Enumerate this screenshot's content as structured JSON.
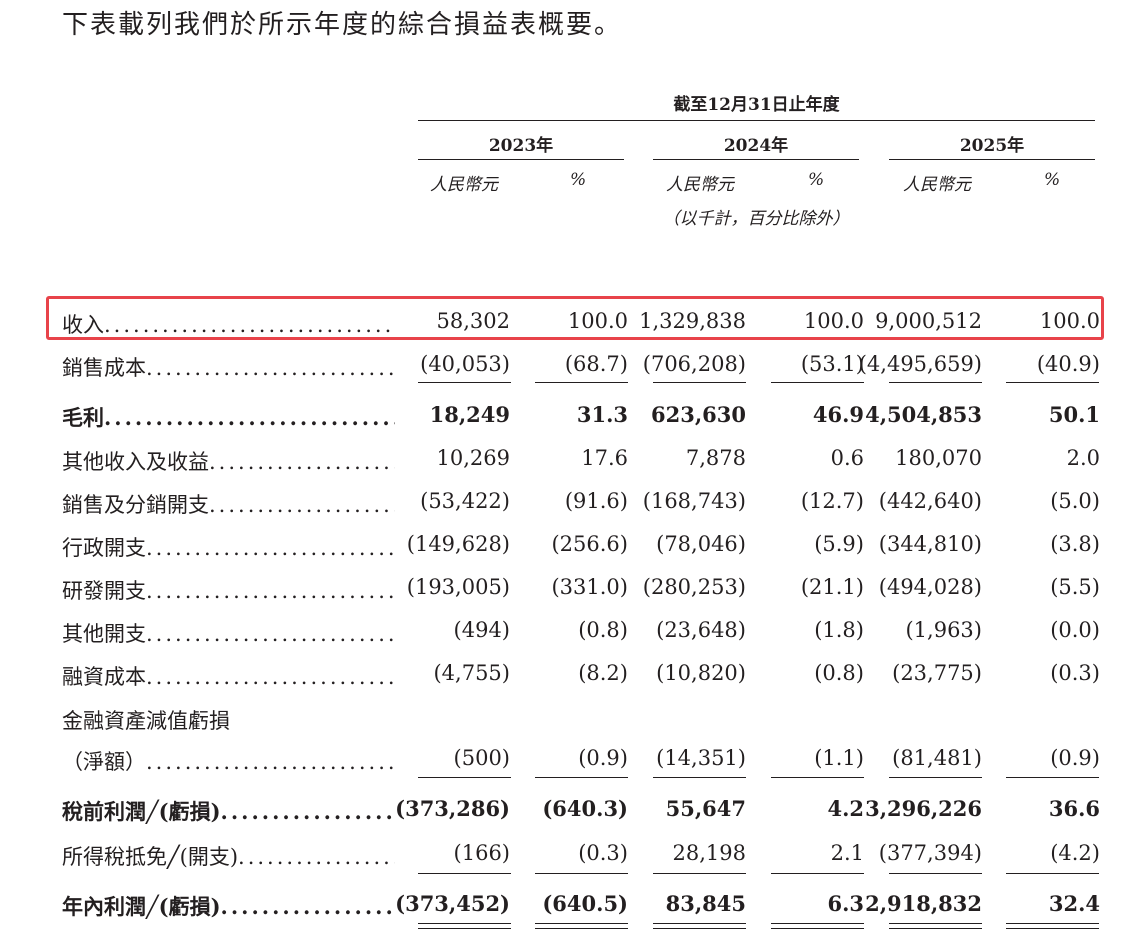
{
  "intro": "下表載列我們於所示年度的綜合損益表概要。",
  "period_header": "截至12月31日止年度",
  "years": [
    "2023年",
    "2024年",
    "2025年"
  ],
  "unit_rmb": "人民幣元",
  "unit_pct": "%",
  "unit_note": "（以千計，百分比除外）",
  "leader": "...............................",
  "rows": [
    {
      "label": "收入",
      "values": [
        "58,302",
        "100.0",
        "1,329,838",
        "100.0",
        "9,000,512",
        "100.0"
      ]
    },
    {
      "label": "銷售成本",
      "values": [
        "(40,053)",
        "(68.7)",
        "(706,208)",
        "(53.1)",
        "(4,495,659)",
        "(40.9)"
      ]
    },
    {
      "label": "毛利",
      "values": [
        "18,249",
        "31.3",
        "623,630",
        "46.9",
        "4,504,853",
        "50.1"
      ]
    },
    {
      "label": "其他收入及收益",
      "values": [
        "10,269",
        "17.6",
        "7,878",
        "0.6",
        "180,070",
        "2.0"
      ]
    },
    {
      "label": "銷售及分銷開支",
      "values": [
        "(53,422)",
        "(91.6)",
        "(168,743)",
        "(12.7)",
        "(442,640)",
        "(5.0)"
      ]
    },
    {
      "label": "行政開支",
      "values": [
        "(149,628)",
        "(256.6)",
        "(78,046)",
        "(5.9)",
        "(344,810)",
        "(3.8)"
      ]
    },
    {
      "label": "研發開支",
      "values": [
        "(193,005)",
        "(331.0)",
        "(280,253)",
        "(21.1)",
        "(494,028)",
        "(5.5)"
      ]
    },
    {
      "label": "其他開支",
      "values": [
        "(494)",
        "(0.8)",
        "(23,648)",
        "(1.8)",
        "(1,963)",
        "(0.0)"
      ]
    },
    {
      "label": "融資成本",
      "values": [
        "(4,755)",
        "(8.2)",
        "(10,820)",
        "(0.8)",
        "(23,775)",
        "(0.3)"
      ]
    },
    {
      "label": "金融資產減值虧損",
      "values": []
    },
    {
      "label": "（淨額）",
      "values": [
        "(500)",
        "(0.9)",
        "(14,351)",
        "(1.1)",
        "(81,481)",
        "(0.9)"
      ]
    },
    {
      "label": "稅前利潤╱(虧損)",
      "values": [
        "(373,286)",
        "(640.3)",
        "55,647",
        "4.2",
        "3,296,226",
        "36.6"
      ]
    },
    {
      "label": "所得稅抵免╱(開支)",
      "values": [
        "(166)",
        "(0.3)",
        "28,198",
        "2.1",
        "(377,394)",
        "(4.2)"
      ]
    },
    {
      "label": "年內利潤╱(虧損)",
      "values": [
        "(373,452)",
        "(640.5)",
        "83,845",
        "6.3",
        "2,918,832",
        "32.4"
      ]
    }
  ]
}
